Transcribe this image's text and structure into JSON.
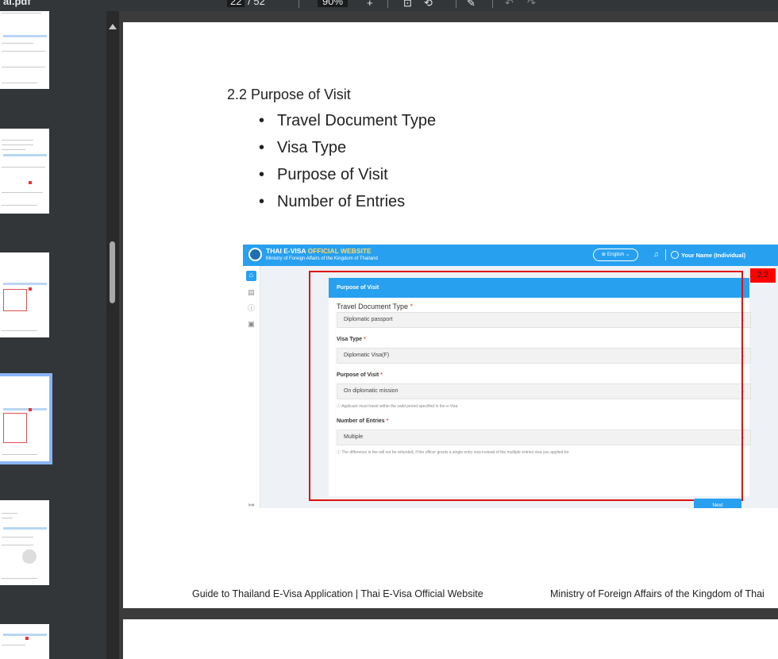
{
  "toolbar": {
    "filename": "al.pdf",
    "page_current": "22",
    "page_sep": "/",
    "page_total": "52",
    "zoom": "90%",
    "zoom_in": "+"
  },
  "page": {
    "heading": "2.2 Purpose of Visit",
    "bullets": [
      "Travel Document Type",
      "Visa Type",
      "Purpose of Visit",
      "Number of Entries"
    ],
    "footer_left": "Guide to Thailand E-Visa Application | Thai E-Visa Official Website",
    "footer_right": "Ministry of Foreign Affairs of the Kingdom of Thai"
  },
  "screenshot": {
    "site_title_a": "THAI E-VISA",
    "site_title_b": "OFFICIAL WEBSITE",
    "site_subtitle": "Ministry of Foreign Affairs of the Kingdom of Thailand",
    "language": "English",
    "user": "Your Name  (Individual)",
    "card_title": "Purpose of Visit",
    "tag": "2.2",
    "fields": {
      "travel_doc_label": "Travel Document Type",
      "travel_doc_value": "Diplomatic passport",
      "visa_type_label": "Visa Type",
      "visa_type_value": "Diplomatic Visa(F)",
      "purpose_label": "Purpose of Visit",
      "purpose_value": "On diplomatic mission",
      "purpose_hint": "Applicant must travel within the valid period specified in the e-Visa",
      "entries_label": "Number of Entries",
      "entries_value": "Multiple",
      "entries_hint": "The difference in fee will not be refunded, if the officer grants a single entry visa instead of the multiple entries visa you applied for."
    },
    "required_mark": "*",
    "next_label": "Next"
  },
  "colors": {
    "accent_blue": "#27a0f0",
    "highlight_red": "#e01010",
    "selection": "#8ab4f8"
  }
}
